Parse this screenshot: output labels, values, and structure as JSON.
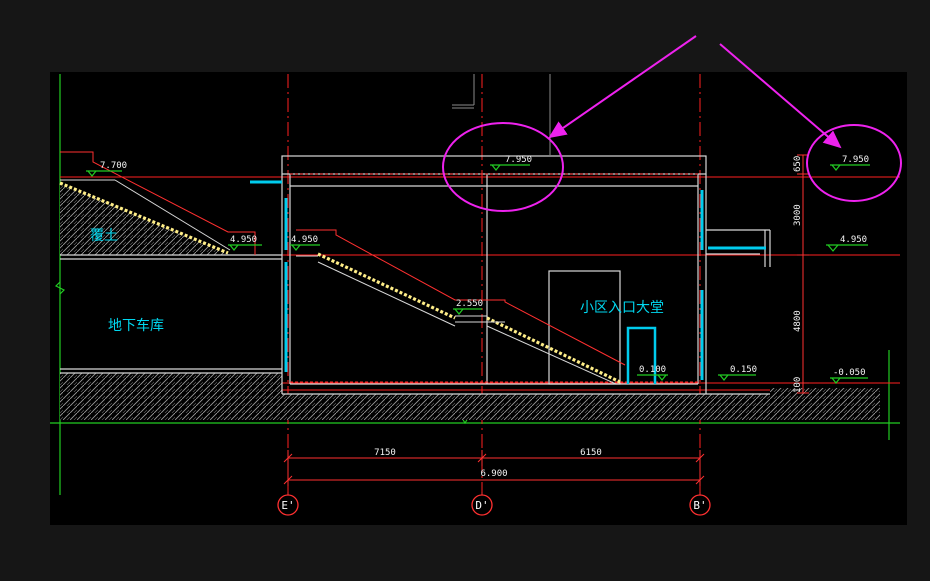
{
  "drawing": {
    "room_labels": {
      "fill_soil": "覆土",
      "garage": "地下车库",
      "lobby": "小区入口大堂"
    },
    "elevations": {
      "top_left": "7.700",
      "roof_mid": "7.950",
      "roof_right": "7.950",
      "garage_top": "4.950",
      "hall_upper": "4.950",
      "right_mid": "4.950",
      "landing": "2.550",
      "lobby_floor": "0.100",
      "outdoor_floor": "0.150",
      "right_low": "-0.050"
    },
    "vertical_dims": [
      "650",
      "3000",
      "4800",
      "100"
    ],
    "horizontal_dims": {
      "left_span": "7150",
      "right_span": "6150",
      "total": "6.900"
    },
    "axis_labels": [
      "E'",
      "D'",
      "B'"
    ]
  },
  "annotations": {
    "colors": {
      "highlight": "#ee22ee",
      "axis": "#ff2020",
      "frame": "#22cc22",
      "stair": "#ffee88",
      "glass": "#00ccee"
    }
  }
}
